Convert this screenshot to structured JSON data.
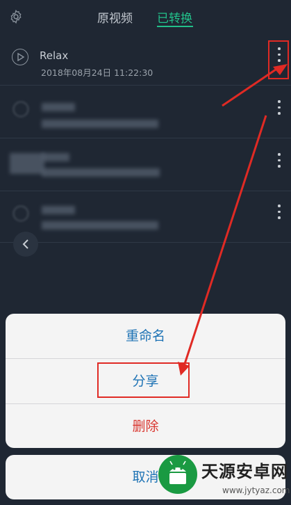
{
  "header": {
    "tabs": [
      {
        "label": "原视频"
      },
      {
        "label": "已转换"
      }
    ],
    "active_tab": "已转换"
  },
  "files": [
    {
      "title": "Relax",
      "timestamp": "2018年08月24日 11:22:30",
      "blurred": false
    },
    {
      "blurred": true
    },
    {
      "blurred": true
    },
    {
      "blurred": true
    }
  ],
  "action_sheet": {
    "items": [
      {
        "label": "重命名"
      },
      {
        "label": "分享"
      },
      {
        "label": "删除"
      }
    ],
    "cancel_label": "取消"
  },
  "watermark": {
    "name": "天源安卓网",
    "url": "www.jytyaz.com"
  },
  "colors": {
    "background": "#1f2733",
    "accent": "#22c08a",
    "sheet_text": "#1e73b5",
    "destructive": "#d9362f",
    "annotation": "#e02a24"
  },
  "icons": [
    "gear-icon",
    "play-icon",
    "more-vertical-icon",
    "chevron-left-icon",
    "android-logo-icon"
  ]
}
